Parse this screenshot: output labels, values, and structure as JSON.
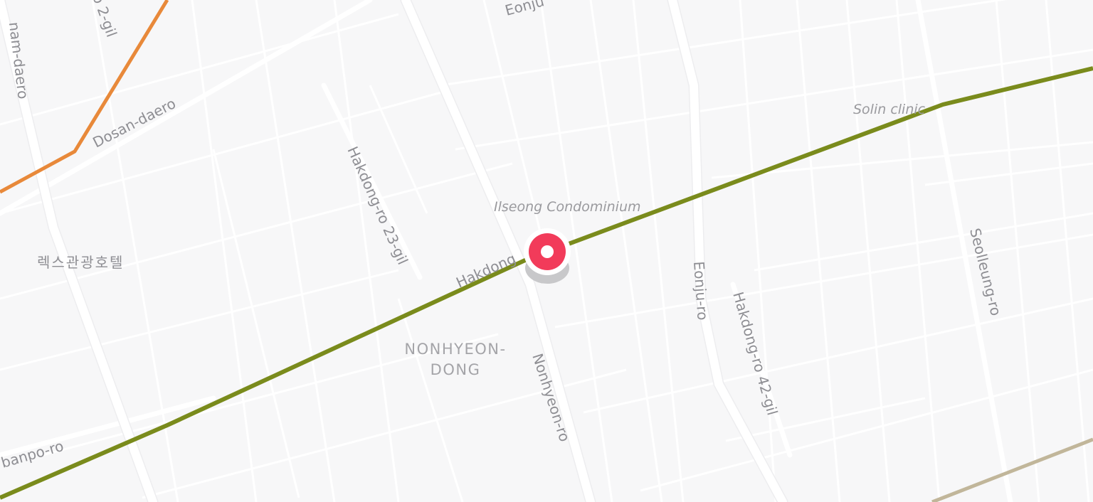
{
  "map": {
    "road_labels": {
      "nonhyeon_ro": "Nonhyeon-ro",
      "eonju_ro": "Eonju-ro",
      "eonju_top": "Eonju",
      "seolleung_ro": "Seolleung-ro",
      "hakdong_ro_23": "Hakdong-ro 23-gil",
      "hakdong_ro_42": "Hakdong-ro 42-gil",
      "hakdong_ro": "Hakdong",
      "dosan_daero": "Dosan-daero",
      "sinbanpo_ro": "banpo-ro",
      "gangnam_daero": "nam-daero",
      "ro_2gil": "o 2-gil"
    },
    "poi_labels": {
      "ilseong": "Ilseong Condominium",
      "solin": "Solin clinic",
      "rex_hotel": "렉스관광호텔"
    },
    "area_label": {
      "line1": "NONHYEON-",
      "line2": "DONG"
    },
    "colors": {
      "background": "#f7f7f8",
      "road": "#ffffff",
      "line7": "#7a8b1c",
      "line3": "#e8893a",
      "line9": "#c1b69a",
      "marker": "#f23b5a"
    },
    "marker": {
      "icon": "location-pin-icon"
    }
  }
}
